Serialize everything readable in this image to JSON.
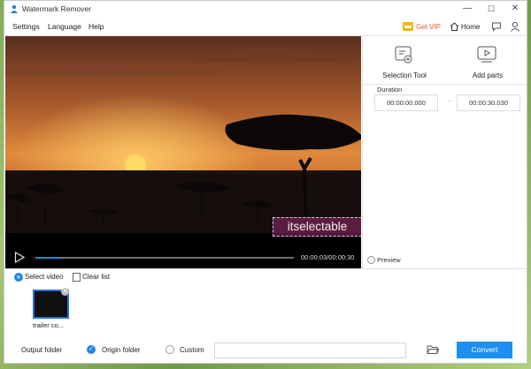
{
  "window": {
    "title": "Watermark Remover",
    "controls": {
      "minimize": "—",
      "maximize": "☐",
      "close": "✕"
    }
  },
  "menu": {
    "items": [
      {
        "label": "Settings"
      },
      {
        "label": "Language"
      },
      {
        "label": "Help"
      }
    ],
    "vip_label": "Get VIP",
    "home_label": "Home",
    "icons": [
      "crown-icon",
      "home-icon",
      "chat-icon",
      "user-icon"
    ]
  },
  "video": {
    "selection_text": "itselectable",
    "time": "00:00:03/00:00:30",
    "progress": 0.1,
    "accent": "#1a8ce0"
  },
  "right_panel": {
    "tools": [
      {
        "label": "Selection Tool",
        "icon": "selection-tool-icon"
      },
      {
        "label": "Add parts",
        "icon": "add-parts-icon"
      }
    ],
    "duration_label": "Duration",
    "start_time": "00:00:00.000",
    "end_time": "00:00:30.030",
    "preview_label": "Preview"
  },
  "list": {
    "select_label": "Select video",
    "clear_label": "Clear list",
    "thumbnails": [
      {
        "caption": "trailer co..."
      }
    ]
  },
  "bottom": {
    "output_label": "Output folder",
    "origin_label": "Origin folder",
    "custom_label": "Custom",
    "path_value": "",
    "convert_label": "Convert",
    "convert_color": "#1e8ff0"
  }
}
